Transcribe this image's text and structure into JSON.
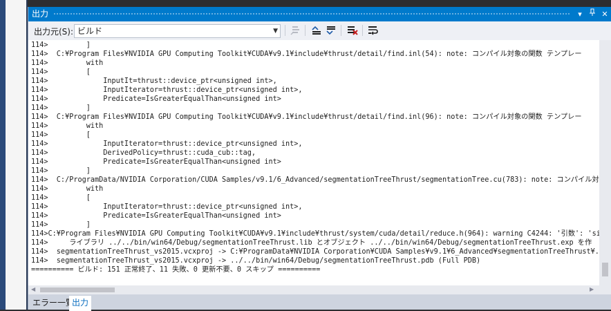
{
  "window": {
    "title": "出力"
  },
  "toolbar": {
    "source_label": "出力元(S):",
    "source_value": "ビルド"
  },
  "output": {
    "lines": [
      "114>         ]",
      "114>  C:¥Program Files¥NVIDIA GPU Computing Toolkit¥CUDA¥v9.1¥include¥thrust/detail/find.inl(54): note: コンパイル対象の関数 テンプレー",
      "114>         with",
      "114>         [",
      "114>             InputIt=thrust::device_ptr<unsigned int>,",
      "114>             InputIterator=thrust::device_ptr<unsigned int>,",
      "114>             Predicate=IsGreaterEqualThan<unsigned int>",
      "114>         ]",
      "114>  C:¥Program Files¥NVIDIA GPU Computing Toolkit¥CUDA¥v9.1¥include¥thrust/detail/find.inl(96): note: コンパイル対象の関数 テンプレー",
      "114>         with",
      "114>         [",
      "114>             InputIterator=thrust::device_ptr<unsigned int>,",
      "114>             DerivedPolicy=thrust::cuda_cub::tag,",
      "114>             Predicate=IsGreaterEqualThan<unsigned int>",
      "114>         ]",
      "114>  C:/ProgramData/NVIDIA Corporation/CUDA Samples/v9.1/6_Advanced/segmentationTreeThrust/segmentationTree.cu(783): note: コンパイル対",
      "114>         with",
      "114>         [",
      "114>             InputIterator=thrust::device_ptr<unsigned int>,",
      "114>             Predicate=IsGreaterEqualThan<unsigned int>",
      "114>         ]",
      "114>C:¥Program Files¥NVIDIA GPU Computing Toolkit¥CUDA¥v9.1¥include¥thrust/system/cuda/detail/reduce.h(964): warning C4244: '引数': 'si",
      "114>     ライブラリ ../../bin/win64/Debug/segmentationTreeThrust.lib とオブジェクト ../../bin/win64/Debug/segmentationTreeThrust.exp を作",
      "114>  segmentationTreeThrust_vs2015.vcxproj -> C:¥ProgramData¥NVIDIA Corporation¥CUDA Samples¥v9.1¥6_Advanced¥segmentationTreeThrust¥..¥",
      "114>  segmentationTreeThrust_vs2015.vcxproj -> ../../bin/win64/Debug/segmentationTreeThrust.pdb (Full PDB)",
      "========== ビルド: 151 正常終了、11 失敗、0 更新不要、0 スキップ =========="
    ]
  },
  "tabs": [
    {
      "label": "エラー一覧"
    },
    {
      "label": "出力"
    }
  ],
  "icons": {
    "goto-message": "goto-message-icon",
    "prev-message": "prev-message-icon",
    "next-message": "next-message-icon",
    "clear-all": "clear-all-icon",
    "word-wrap": "word-wrap-icon"
  },
  "colors": {
    "titlebar": "#007acc",
    "active_tab_text": "#0e70c0",
    "panel": "#ced4df"
  }
}
